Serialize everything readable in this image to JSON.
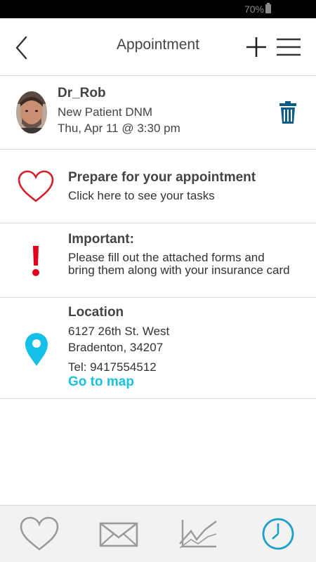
{
  "status_bar": {
    "battery": "70%"
  },
  "header": {
    "title": "Appointment"
  },
  "appointment": {
    "doctor": "Dr_Rob",
    "type": "New Patient DNM",
    "datetime": "Thu, Apr 11 @ 3:30 pm"
  },
  "prepare": {
    "title": "Prepare for your appointment",
    "subtitle": "Click here to see your tasks"
  },
  "important": {
    "title": "Important:",
    "message": "Please fill out the attached forms and bring them along with your insurance card"
  },
  "location": {
    "title": "Location",
    "address_line1": "6127 26th St. West",
    "address_line2": "Bradenton, 34207",
    "tel": "Tel: 9417554512",
    "map_link": "Go to map"
  },
  "colors": {
    "heart": "#d41f2b",
    "alert": "#e0001a",
    "pin": "#15c0e8",
    "link": "#1bbfe0",
    "trash": "#0d5c86",
    "nav_active": "#1aa0c8",
    "nav_inactive": "#9a9a9a"
  },
  "icons": [
    "back-arrow-icon",
    "plus-icon",
    "menu-icon",
    "trash-icon",
    "heart-icon",
    "exclamation-icon",
    "location-pin-icon",
    "nav-heart-icon",
    "nav-mail-icon",
    "nav-chart-icon",
    "nav-clock-icon"
  ]
}
